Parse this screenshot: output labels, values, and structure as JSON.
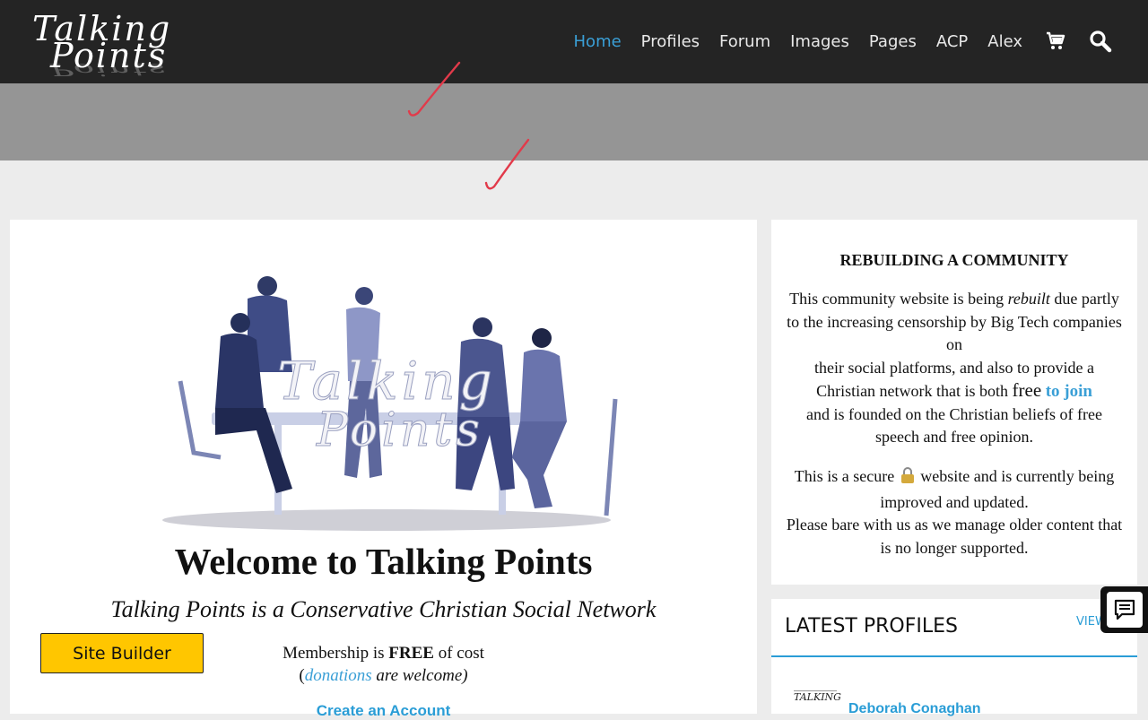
{
  "header": {
    "logo_line1": "Talking",
    "logo_line2": "Points",
    "nav": [
      {
        "label": "Home",
        "active": true
      },
      {
        "label": "Profiles"
      },
      {
        "label": "Forum"
      },
      {
        "label": "Images"
      },
      {
        "label": "Pages"
      },
      {
        "label": "ACP"
      },
      {
        "label": "Alex"
      }
    ],
    "icons": [
      "cart-icon",
      "search-icon"
    ]
  },
  "hero": {
    "overlay_line1": "Talking",
    "overlay_line2": "Points"
  },
  "main": {
    "welcome": "Welcome to Talking Points",
    "tagline": "Talking Points is a Conservative Christian Social Network",
    "membership_prefix": "Membership is ",
    "membership_bold": "FREE",
    "membership_suffix": " of cost",
    "donations_open": "(",
    "donations_link": "donations",
    "donations_suffix": " are welcome)",
    "create_account": "Create an Account",
    "site_builder": "Site Builder"
  },
  "sidebar": {
    "community_title": "REBUILDING A COMMUNITY",
    "p1_a": "This community website is being ",
    "p1_rebuilt": "rebuilt",
    "p1_b": " due partly to the increasing censorship by Big Tech companies on",
    "p1_c": "their social platforms, and also to provide a Christian network that is both ",
    "p1_free": "free",
    "p1_join": "to join",
    "p1_d": "and is founded on the Christian beliefs of free speech and free opinion.",
    "p2_a": "This is a secure",
    "p2_b": "website and is currently being improved and updated.",
    "p2_c": "Please bare with us as we manage older content that is no longer supported.",
    "latest_title": "LATEST PROFILES",
    "view_all": "VIEW",
    "profile_name": "Deborah Conaghan",
    "profile_thumb": "TALKING"
  },
  "colors": {
    "accent": "#3a9fd6",
    "header_bg": "#242424",
    "band_bg": "#959595",
    "button_yellow": "#ffc600"
  }
}
